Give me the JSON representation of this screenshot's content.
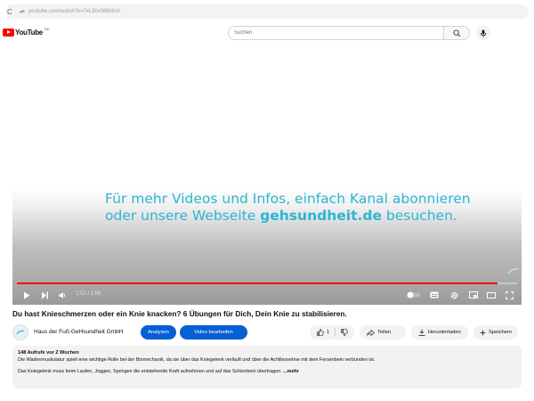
{
  "browser": {
    "url": "youtube.com/watch?v=7xL90vWWdnA",
    "reload_icon": "reload-icon",
    "site_icon": "site-info-icon"
  },
  "header": {
    "logo_text": "YouTube",
    "logo_country": "DE",
    "search_placeholder": "Suchen",
    "search_icon": "search-icon",
    "mic_icon": "microphone-icon"
  },
  "player": {
    "overlay_line1": "Für mehr Videos und Infos, einfach Kanal abonnieren",
    "overlay_line2_prefix": "oder unsere Webseite ",
    "overlay_line2_bold": "gehsundheit.de",
    "overlay_line2_suffix": " besuchen.",
    "time": "1:52 / 1:56",
    "progress": 0.96,
    "colors": {
      "overlay_text": "#2ab6d3",
      "progress": "#ff0000"
    }
  },
  "video": {
    "title": "Du hast Knieschmerzen oder ein Knie knacken? 6 Übungen für Dich, Dein Knie zu stabilisieren.",
    "channel": "Haus der Fuß-GeHsundheit GmbH",
    "analytics_label": "Analysen",
    "edit_label": "Video bearbeiten",
    "likes": "1",
    "share_label": "Teilen",
    "download_label": "Herunterladen",
    "save_label": "Speichern",
    "colors": {
      "primary_button": "#065fd4"
    }
  },
  "description": {
    "meta": "148 Aufrufe  vor 2 Wochen",
    "line1": "Die Wadenmuskulatur spielt eine wichtige Rolle bei der Biomechanik, da sie über das Kniegelenk verläuft und über die Achillessehne mit dem Fersenbein verbunden ist.",
    "line2": "Das Kniegelenk muss beim Laufen, Joggen, Springen die entstehende Kraft aufnehmen und auf das Schienbein übertragen. ",
    "more": "...mehr"
  }
}
